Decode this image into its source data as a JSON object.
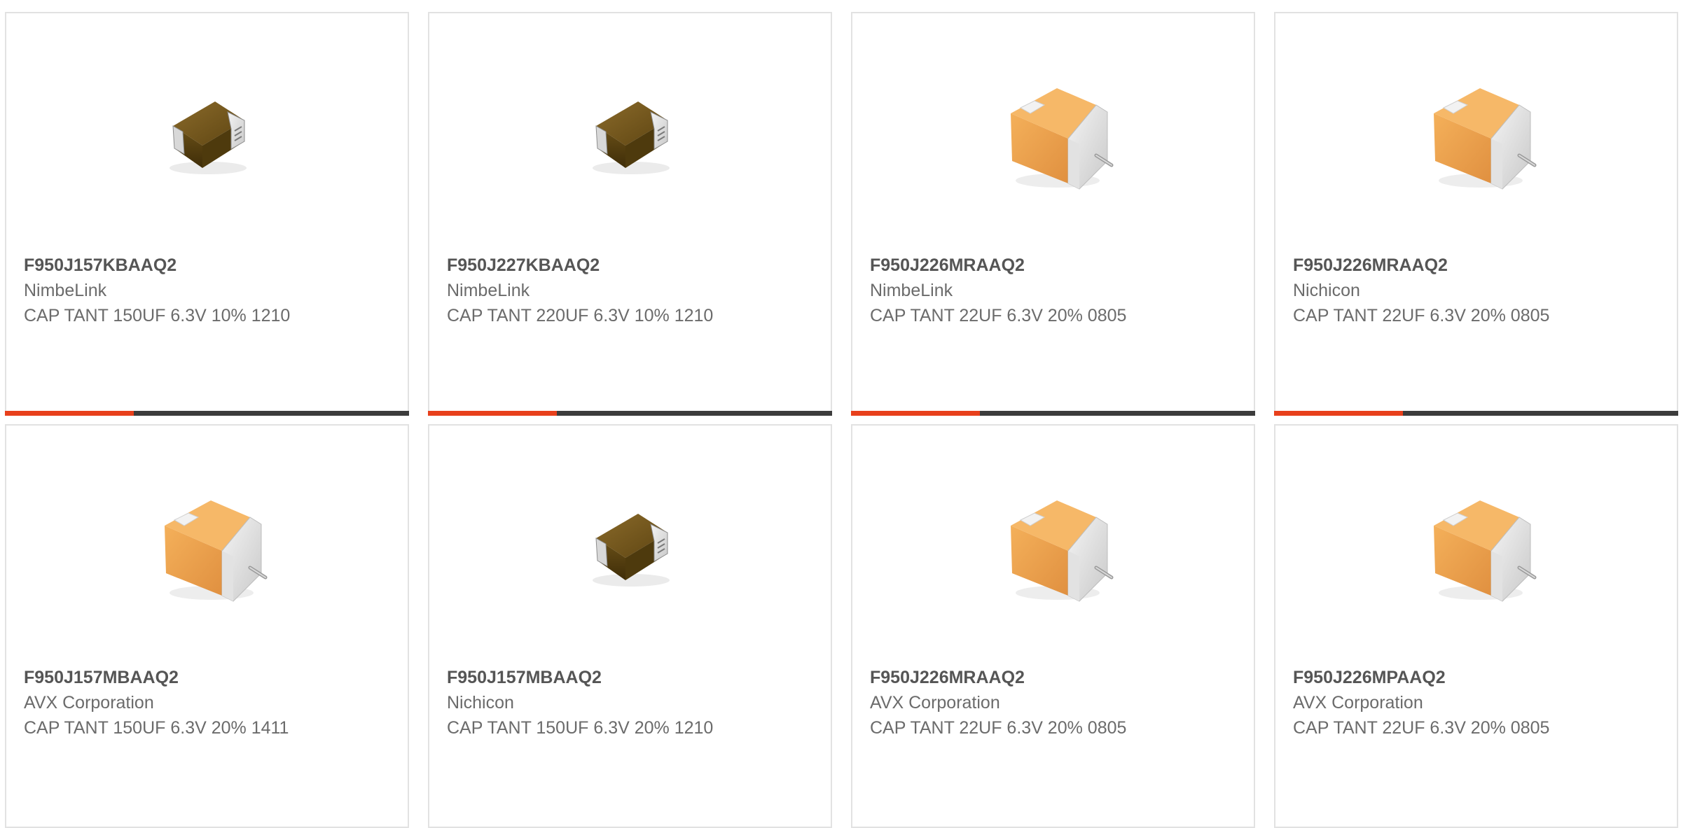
{
  "theme": {
    "accent": "#e8401c",
    "bar": "#3c3c3c",
    "border": "#e2e2e2"
  },
  "products": [
    {
      "part_number": "F950J157KBAAQ2",
      "manufacturer": "NimbeLink",
      "description": "CAP TANT 150UF 6.3V 10% 1210",
      "image": "brown-smd-capacitor-icon"
    },
    {
      "part_number": "F950J227KBAAQ2",
      "manufacturer": "NimbeLink",
      "description": "CAP TANT 220UF 6.3V 10% 1210",
      "image": "brown-smd-capacitor-icon"
    },
    {
      "part_number": "F950J226MRAAQ2",
      "manufacturer": "NimbeLink",
      "description": "CAP TANT 22UF 6.3V 20% 0805",
      "image": "orange-tantalum-capacitor-icon"
    },
    {
      "part_number": "F950J226MRAAQ2",
      "manufacturer": "Nichicon",
      "description": "CAP TANT 22UF 6.3V 20% 0805",
      "image": "orange-tantalum-capacitor-icon"
    },
    {
      "part_number": "F950J157MBAAQ2",
      "manufacturer": "AVX Corporation",
      "description": "CAP TANT 150UF 6.3V 20% 1411",
      "image": "orange-tantalum-capacitor-icon"
    },
    {
      "part_number": "F950J157MBAAQ2",
      "manufacturer": "Nichicon",
      "description": "CAP TANT 150UF 6.3V 20% 1210",
      "image": "brown-smd-capacitor-icon"
    },
    {
      "part_number": "F950J226MRAAQ2",
      "manufacturer": "AVX Corporation",
      "description": "CAP TANT 22UF 6.3V 20% 0805",
      "image": "orange-tantalum-capacitor-icon"
    },
    {
      "part_number": "F950J226MPAAQ2",
      "manufacturer": "AVX Corporation",
      "description": "CAP TANT 22UF 6.3V 20% 0805",
      "image": "orange-tantalum-capacitor-icon"
    }
  ]
}
